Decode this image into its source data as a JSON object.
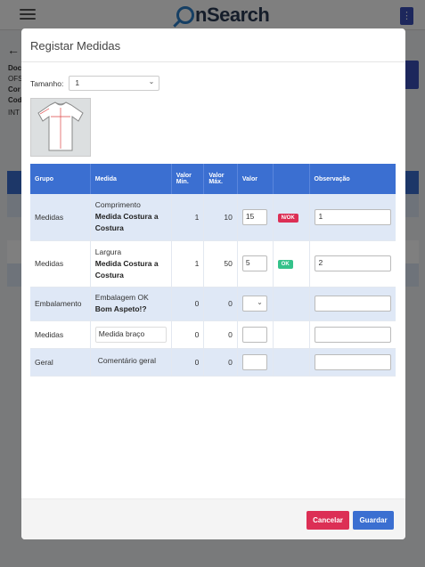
{
  "app": {
    "logo_text": "nSearch"
  },
  "modal": {
    "title": "Registar Medidas",
    "size_label": "Tamanho:",
    "size_value": "1",
    "columns": [
      "Grupo",
      "Medida",
      "Valor Min.",
      "Valor Máx.",
      "Valor",
      "",
      "Observação"
    ],
    "rows": [
      {
        "grupo": "Medidas",
        "medida_line1": "Comprimento",
        "medida_bold": "Medida Costura a Costura",
        "min": "1",
        "max": "10",
        "valor": "15",
        "status": "N/OK",
        "obs": "1"
      },
      {
        "grupo": "Medidas",
        "medida_line1": "Largura",
        "medida_bold": "Medida Costura a Costura",
        "min": "1",
        "max": "50",
        "valor": "5",
        "status": "OK",
        "obs": "2"
      },
      {
        "grupo": "Embalamento",
        "medida_line1": "Embalagem OK",
        "medida_bold": "Bom Aspeto!?",
        "min": "0",
        "max": "0",
        "valor": "",
        "status": "",
        "obs": ""
      },
      {
        "grupo": "Medidas",
        "medida_input": "Medida braço",
        "min": "0",
        "max": "0",
        "valor": "",
        "status": "",
        "obs": ""
      },
      {
        "grupo": "Geral",
        "medida_input": "Comentário geral",
        "min": "0",
        "max": "0",
        "valor": "",
        "status": "",
        "obs": ""
      }
    ],
    "cancel_label": "Cancelar",
    "save_label": "Guardar"
  },
  "colors": {
    "header_blue": "#3b6fd1",
    "danger": "#dc2f55",
    "success": "#34c28a"
  }
}
